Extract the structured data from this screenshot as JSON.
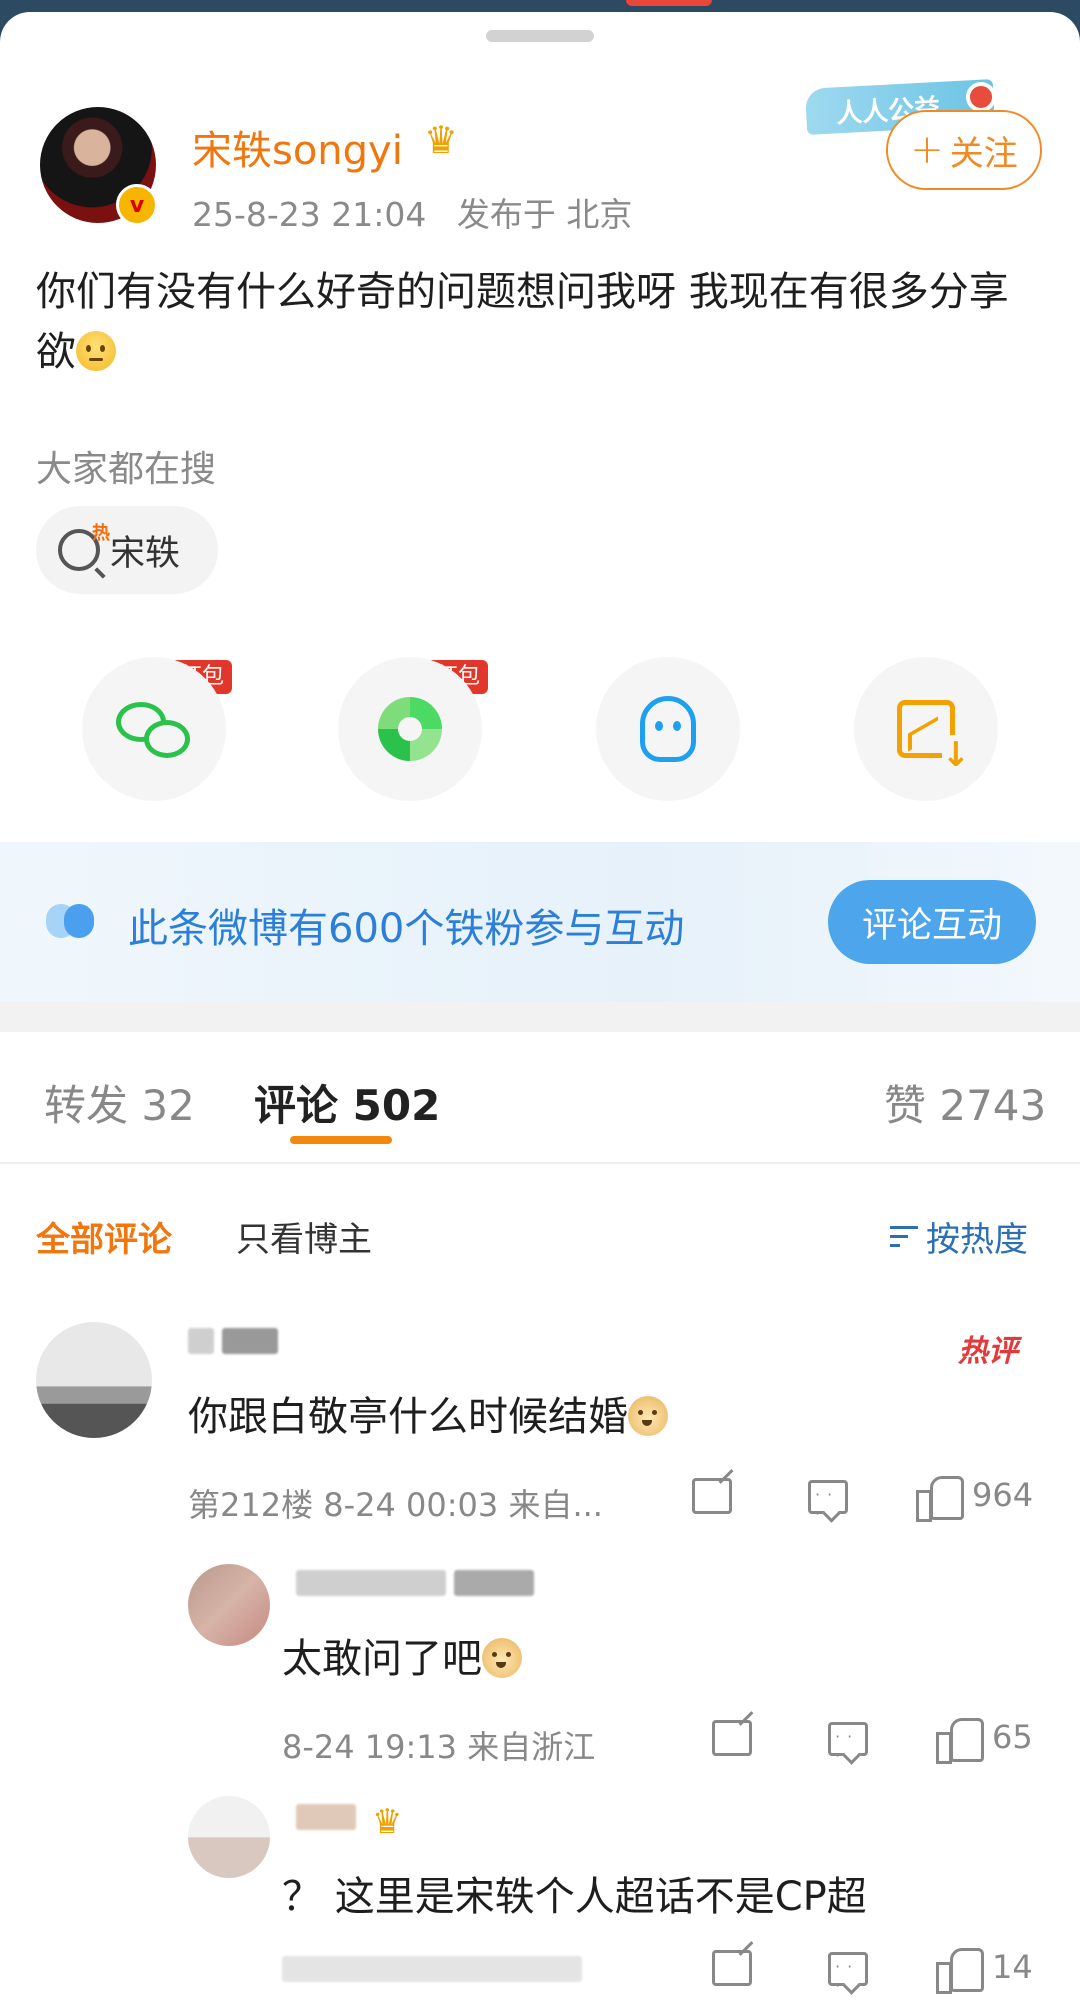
{
  "post": {
    "username": "宋轶songyi",
    "time": "25-8-23 21:04",
    "location": "发布于 北京",
    "text": "你们有没有什么好奇的问题想问我呀 我现在有很多分享欲",
    "follow_label": "关注",
    "badge_text": "人人公益"
  },
  "search": {
    "label": "大家都在搜",
    "chip": "宋轶"
  },
  "share": {
    "redpack_label": "领红包",
    "items": [
      "wechat",
      "moments",
      "qq",
      "save-image"
    ]
  },
  "fan_banner": {
    "text": "此条微博有600个铁粉参与互动",
    "button": "评论互动"
  },
  "tabs": {
    "repost": "转发 32",
    "comment": "评论 502",
    "like": "赞 2743"
  },
  "filters": {
    "all": "全部评论",
    "owner_only": "只看博主",
    "sort": "按热度"
  },
  "comments": [
    {
      "hot_tag": "热评",
      "text": "你跟白敬亭什么时候结婚",
      "meta": "第212楼 8-24 00:03 来自...",
      "likes": "964"
    },
    {
      "text": "太敢问了吧",
      "meta": "8-24 19:13 来自浙江",
      "likes": "65"
    },
    {
      "text": "？ 这里是宋轶个人超话不是CP超",
      "likes": "14"
    }
  ],
  "colors": {
    "accent_orange": "#f2760e",
    "link_blue": "#2c6fb5",
    "hot_red": "#e23a3a"
  }
}
